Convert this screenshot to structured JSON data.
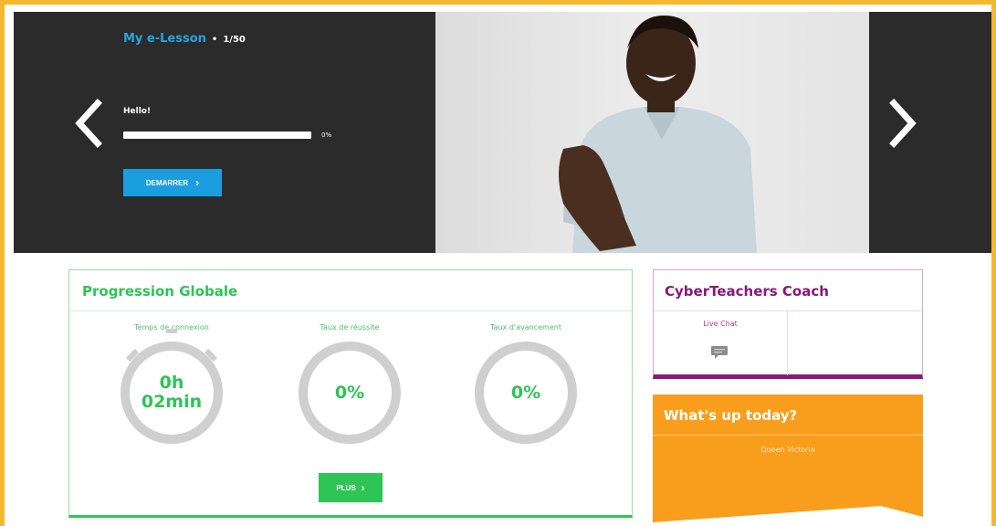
{
  "hero": {
    "title": "My e-Lesson",
    "separator": "•",
    "lesson_count": "1/50",
    "lesson_name": "Hello!",
    "progress_label": "0%",
    "progress": 0,
    "start_button": "DEMARRER",
    "prev_icon": "chevron-left-icon",
    "next_icon": "chevron-right-icon"
  },
  "progression": {
    "title": "Progression Globale",
    "stats": [
      {
        "label": "Temps de connexion",
        "value_line1": "0h",
        "value_line2": "02min"
      },
      {
        "label": "Taux de réussite",
        "value_line1": "0%",
        "value_line2": ""
      },
      {
        "label": "Taux d'avancement",
        "value_line1": "0%",
        "value_line2": ""
      }
    ],
    "more_button": "PLUS"
  },
  "coach": {
    "title": "CyberTeachers Coach",
    "live_chat": "Live Chat",
    "chat_icon": "chat-bubble-icon"
  },
  "whats_up": {
    "title": "What's up today?",
    "subtitle": "Queen Victoria"
  },
  "colors": {
    "frame": "#f5b82e",
    "hero_bg": "#2b2b2b",
    "blue": "#1a9ee0",
    "green": "#2ec456",
    "purple": "#8a1877",
    "orange": "#f99e1c"
  }
}
